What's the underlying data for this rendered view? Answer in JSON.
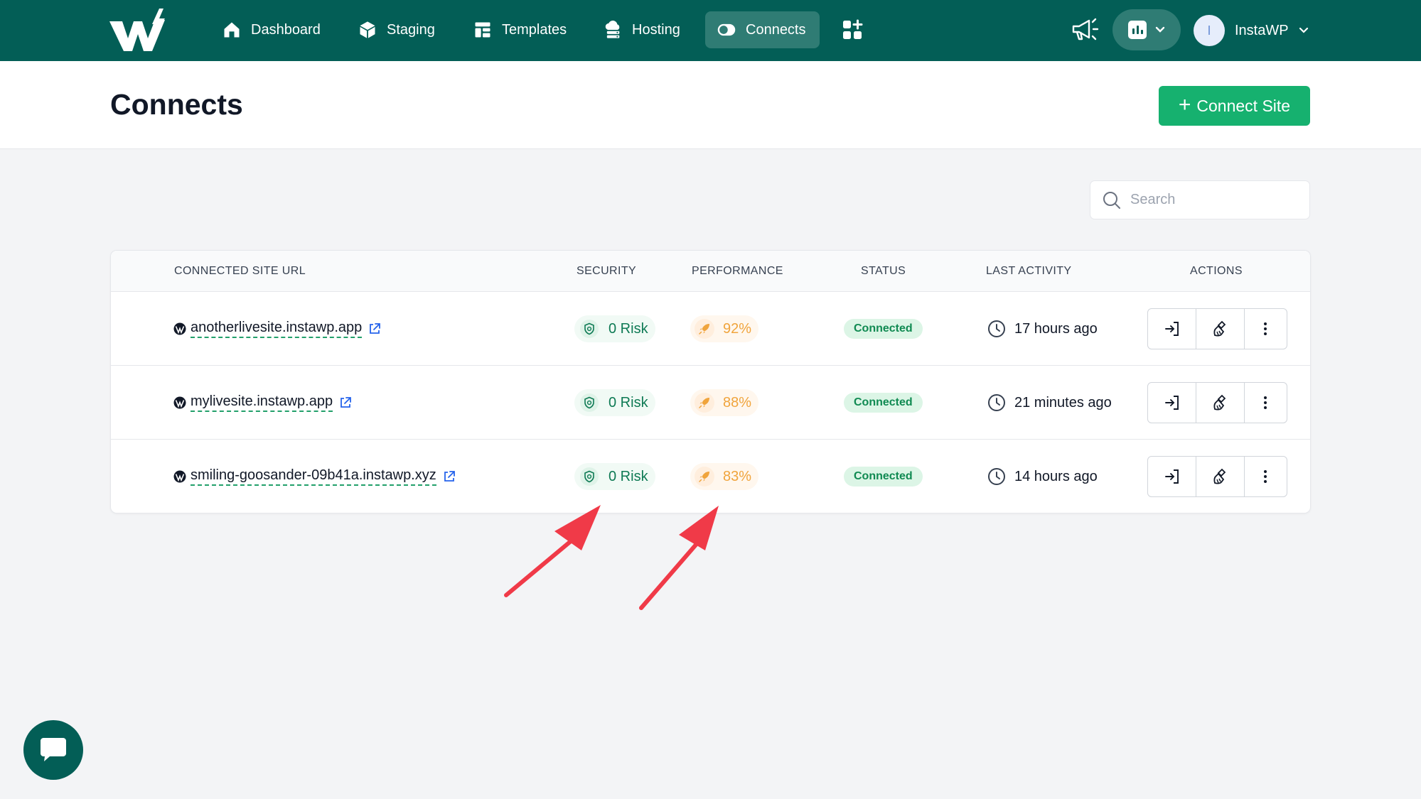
{
  "nav": {
    "items": [
      {
        "label": "Dashboard",
        "icon": "home-icon"
      },
      {
        "label": "Staging",
        "icon": "box-icon"
      },
      {
        "label": "Templates",
        "icon": "layout-icon"
      },
      {
        "label": "Hosting",
        "icon": "cloud-server-icon"
      },
      {
        "label": "Connects",
        "icon": "toggle-icon",
        "active": true
      }
    ],
    "user_name": "InstaWP",
    "avatar_initial": "I"
  },
  "header": {
    "title": "Connects",
    "connect_button": "Connect Site"
  },
  "search": {
    "placeholder": "Search",
    "value": ""
  },
  "table": {
    "columns": {
      "url": "CONNECTED SITE URL",
      "security": "SECURITY",
      "performance": "PERFORMANCE",
      "status": "STATUS",
      "activity": "LAST ACTIVITY",
      "actions": "ACTIONS"
    },
    "rows": [
      {
        "url": "anotherlivesite.instawp.app",
        "security": "0 Risk",
        "performance": "92%",
        "status": "Connected",
        "activity": "17 hours ago"
      },
      {
        "url": "mylivesite.instawp.app",
        "security": "0 Risk",
        "performance": "88%",
        "status": "Connected",
        "activity": "21 minutes ago"
      },
      {
        "url": "smiling-goosander-09b41a.instawp.xyz",
        "security": "0 Risk",
        "performance": "83%",
        "status": "Connected",
        "activity": "14 hours ago"
      }
    ]
  },
  "colors": {
    "nav_bg": "#035e56",
    "nav_active": "#2f7c74",
    "primary_button": "#16b16f",
    "risk_text": "#0e7a54",
    "performance_text": "#f0a43c",
    "status_bg": "#dcf5e6",
    "annotation_arrow": "#f03a48"
  }
}
